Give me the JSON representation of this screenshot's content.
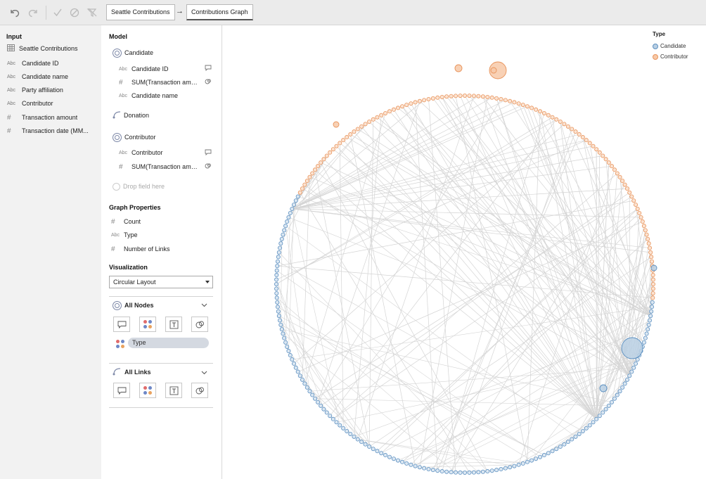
{
  "toolbar": {
    "icons": [
      "undo-icon",
      "redo-icon",
      "check-icon",
      "cancel-icon",
      "clear-filter-icon"
    ],
    "breadcrumbs": [
      "Seattle Contributions",
      "Contributions Graph"
    ],
    "arrow": "→"
  },
  "input": {
    "title": "Input",
    "source": "Seattle Contributions",
    "fields": [
      {
        "type": "Abc",
        "label": "Candidate ID"
      },
      {
        "type": "Abc",
        "label": "Candidate name"
      },
      {
        "type": "Abc",
        "label": "Party affiliation"
      },
      {
        "type": "Abc",
        "label": "Contributor"
      },
      {
        "type": "#",
        "label": "Transaction amount"
      },
      {
        "type": "#",
        "label": "Transaction date (MM..."
      }
    ]
  },
  "model": {
    "title": "Model",
    "candidate": {
      "label": "Candidate",
      "fields": [
        {
          "type": "Abc",
          "label": "Candidate ID"
        },
        {
          "type": "#",
          "label": "SUM(Transaction amo..."
        },
        {
          "type": "Abc",
          "label": "Candidate name"
        }
      ]
    },
    "donation": "Donation",
    "contributor": {
      "label": "Contributor",
      "fields": [
        {
          "type": "Abc",
          "label": "Contributor"
        },
        {
          "type": "#",
          "label": "SUM(Transaction amo..."
        }
      ]
    },
    "drop_placeholder": "Drop field here"
  },
  "graph_properties": {
    "title": "Graph Properties",
    "items": [
      {
        "type": "#",
        "label": "Count"
      },
      {
        "type": "Abc",
        "label": "Type"
      },
      {
        "type": "#",
        "label": "Number of Links"
      }
    ]
  },
  "visualization": {
    "title": "Visualization",
    "layout": "Circular Layout",
    "all_nodes": "All Nodes",
    "node_pill": "Type",
    "all_links": "All Links"
  },
  "legend": {
    "title": "Type",
    "items": [
      {
        "label": "Candidate",
        "color": "#b9cfe3",
        "stroke": "#5b8fc0"
      },
      {
        "label": "Contributor",
        "color": "#f7c9a8",
        "stroke": "#e8935a"
      }
    ]
  },
  "colors": {
    "candidate": "#5b8fc0",
    "contributor": "#e8935a",
    "edge": "#d4d4d4"
  }
}
